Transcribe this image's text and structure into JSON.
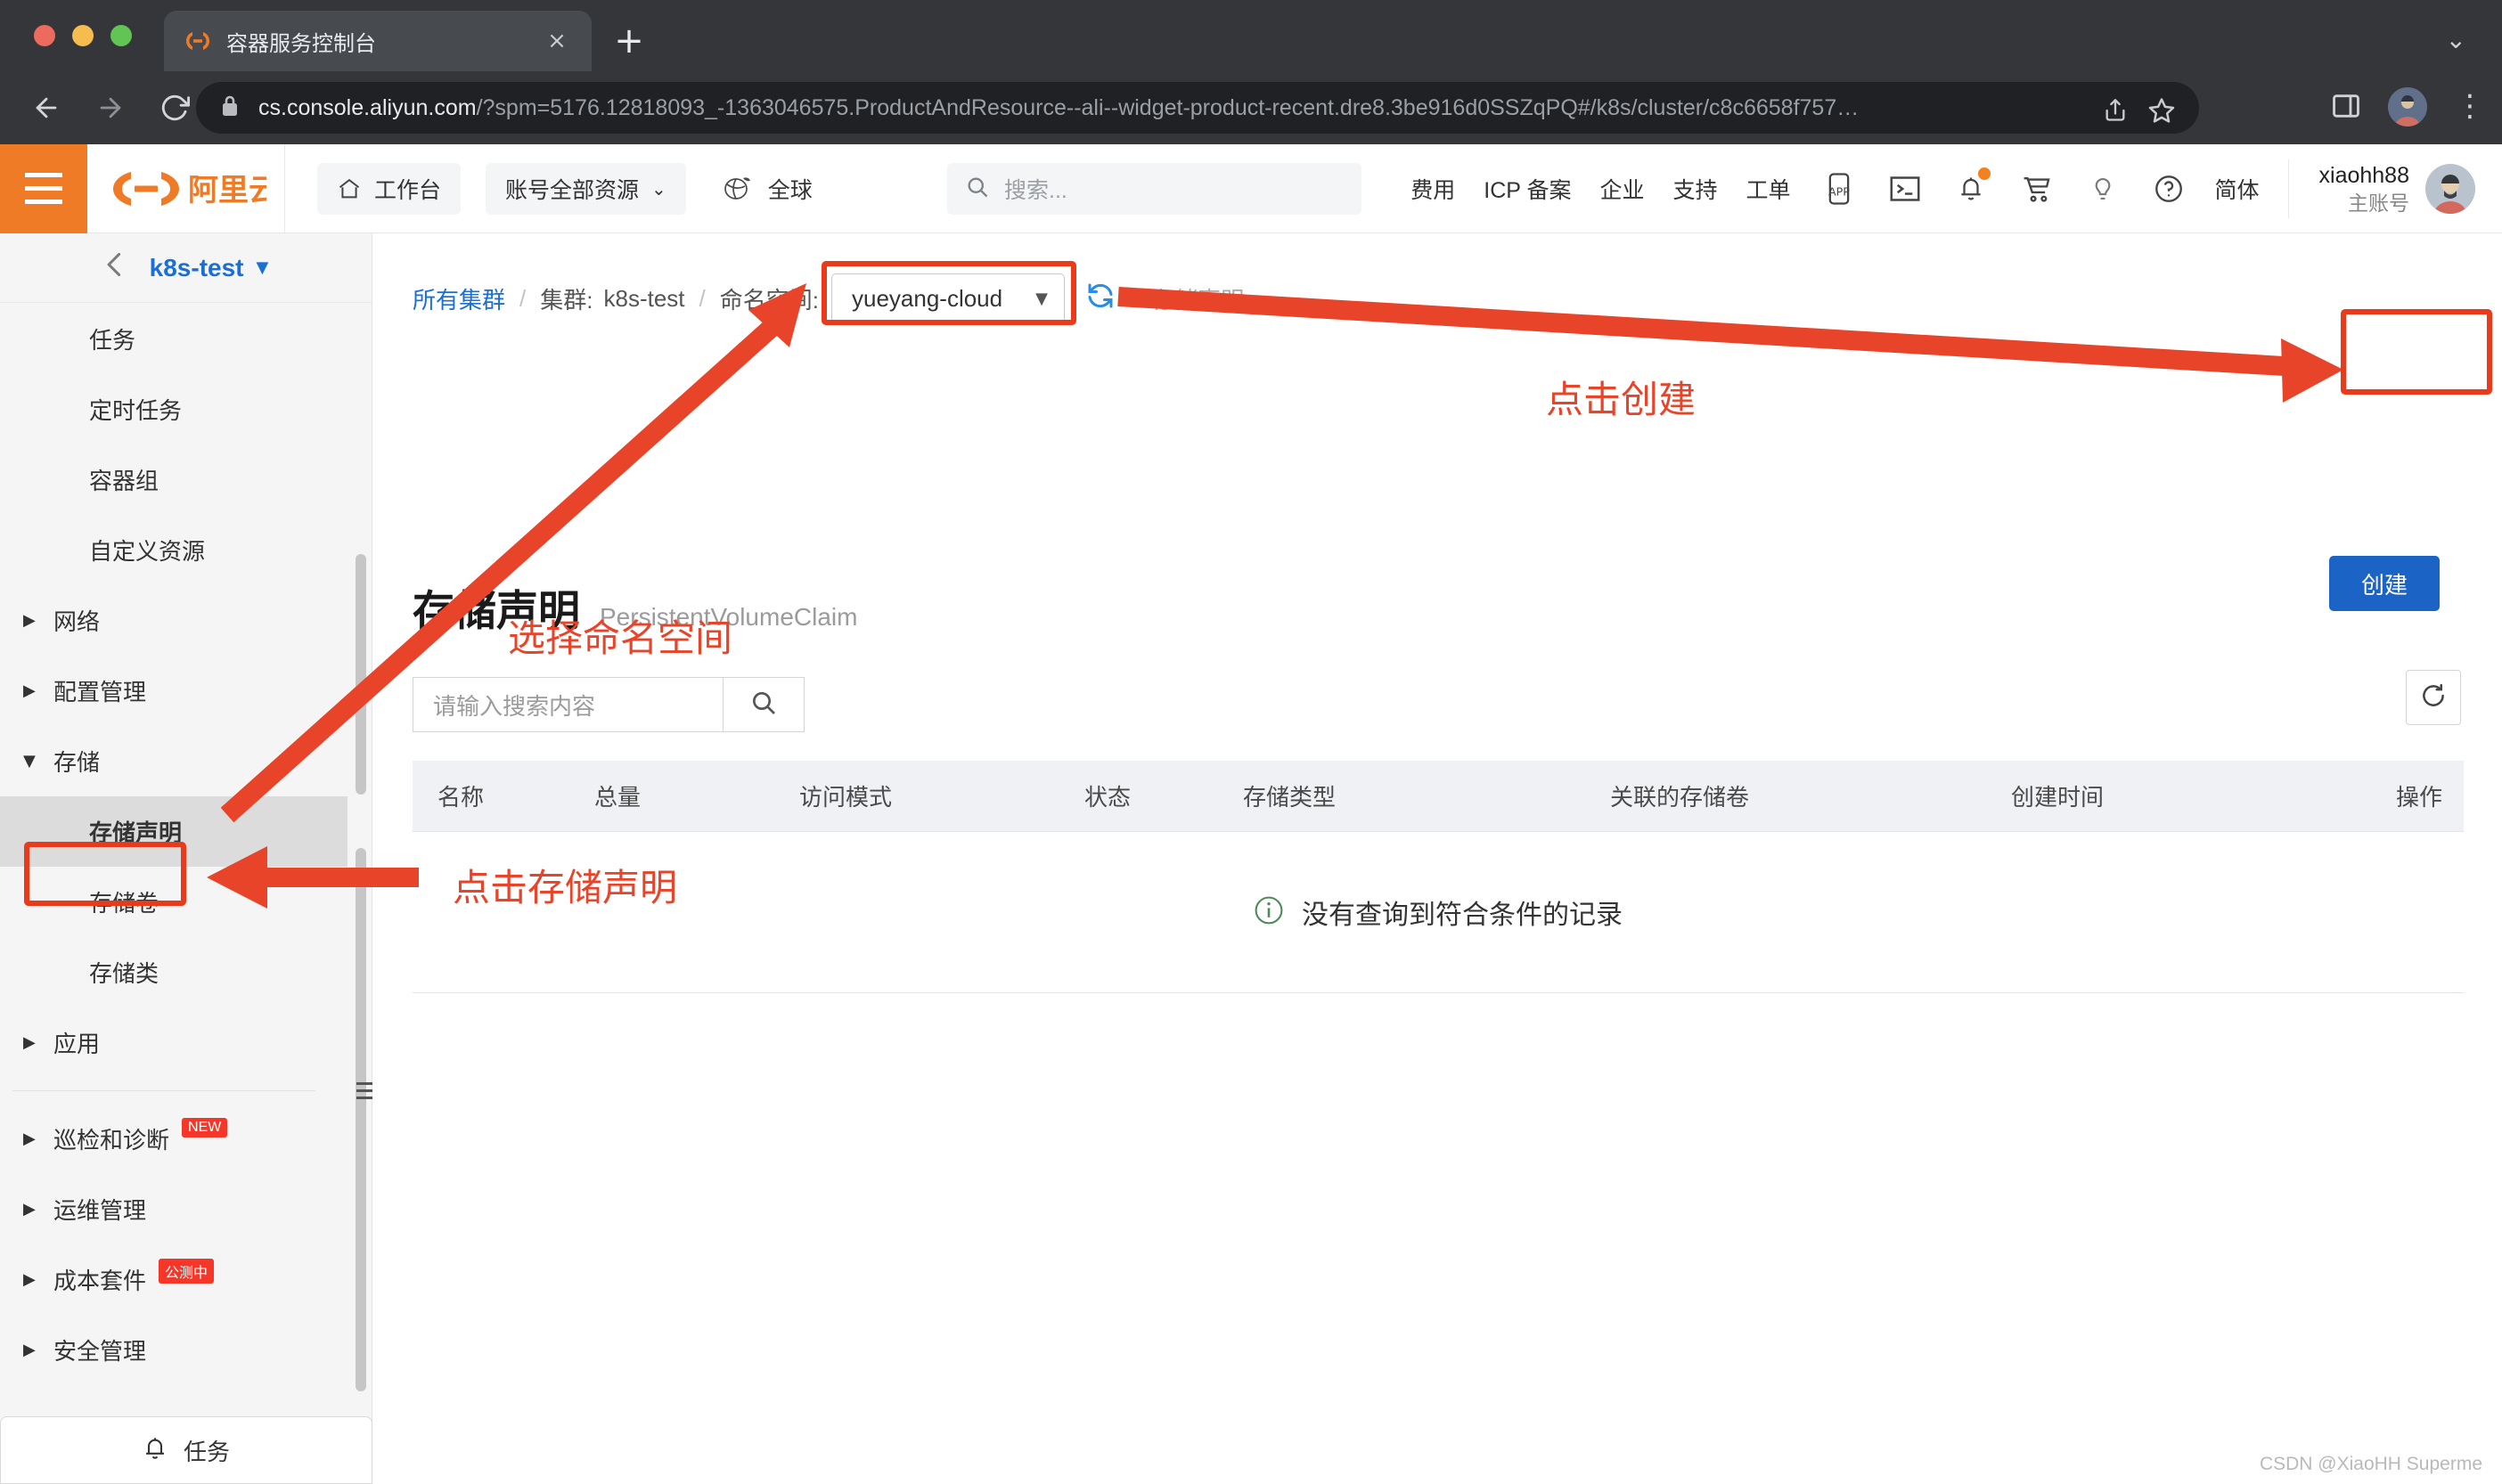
{
  "browser": {
    "tab_title": "容器服务控制台",
    "tab_favicon": "aliyun-logo-icon",
    "tab_close": "×",
    "new_tab": "+",
    "window_menu": "⌄",
    "url_host": "cs.console.aliyun.com",
    "url_rest": "/?spm=5176.12818093_-1363046575.ProductAndResource--ali--widget-product-recent.dre8.3be916d0SSZqPQ#/k8s/cluster/c8c6658f757…",
    "back_icon": "←",
    "forward_icon": "→",
    "reload_icon": "⟳",
    "lock_icon": "lock-icon",
    "share_icon": "share-icon",
    "bookmark_icon": "star-icon",
    "sidepanel_icon": "side-panel-icon",
    "profile_icon": "profile-avatar",
    "menu_icon": "⋮"
  },
  "header": {
    "hamburger": "menu-icon",
    "logo": "阿里云",
    "workbench": "工作台",
    "resources": "账号全部资源",
    "resources_caret": "⌄",
    "region": "全球",
    "globe_icon": "globe-icon",
    "home_icon": "home-icon",
    "search_placeholder": "搜索...",
    "search_icon": "search-icon",
    "links": [
      "费用",
      "ICP 备案",
      "企业",
      "支持",
      "工单"
    ],
    "icons": [
      "app-icon",
      "terminal-icon",
      "bell-icon",
      "cart-icon",
      "bulb-icon",
      "help-icon"
    ],
    "language": "简体",
    "user_name": "xiaohh88",
    "user_sub": "主账号"
  },
  "sidebar": {
    "back_icon": "<",
    "cluster_name": "k8s-test",
    "cluster_caret": "▼",
    "items": [
      {
        "label": "任务",
        "arrow": "",
        "level": "child"
      },
      {
        "label": "定时任务",
        "arrow": "",
        "level": "child"
      },
      {
        "label": "容器组",
        "arrow": "",
        "level": "child"
      },
      {
        "label": "自定义资源",
        "arrow": "",
        "level": "child"
      },
      {
        "label": "网络",
        "arrow": "▶",
        "level": "group"
      },
      {
        "label": "配置管理",
        "arrow": "▶",
        "level": "group"
      },
      {
        "label": "存储",
        "arrow": "▼",
        "level": "group"
      },
      {
        "label": "存储声明",
        "arrow": "",
        "level": "child",
        "active": true
      },
      {
        "label": "存储卷",
        "arrow": "",
        "level": "child"
      },
      {
        "label": "存储类",
        "arrow": "",
        "level": "child"
      },
      {
        "label": "应用",
        "arrow": "▶",
        "level": "group"
      },
      {
        "label": "巡检和诊断",
        "arrow": "▶",
        "level": "group",
        "badge": "NEW"
      },
      {
        "label": "运维管理",
        "arrow": "▶",
        "level": "group"
      },
      {
        "label": "成本套件",
        "arrow": "▶",
        "level": "group",
        "badge": "公测中"
      },
      {
        "label": "安全管理",
        "arrow": "▶",
        "level": "group"
      }
    ],
    "task_button": "任务",
    "task_icon": "bell-icon"
  },
  "main": {
    "breadcrumb": {
      "all_clusters": "所有集群",
      "cluster_label": "集群:",
      "cluster_value": "k8s-test",
      "namespace_label": "命名空间:",
      "namespace_value": "yueyang-cloud",
      "namespace_caret": "▼",
      "refresh_icon": "refresh-icon",
      "current": "存储声明",
      "separator": "/"
    },
    "page_title": "存储声明",
    "page_subtitle": "PersistentVolumeClaim",
    "search_placeholder": "请输入搜索内容",
    "search_icon": "search-icon",
    "refresh_icon": "refresh-icon",
    "create_button": "创建",
    "table": {
      "columns": [
        "名称",
        "总量",
        "访问模式",
        "状态",
        "存储类型",
        "关联的存储卷",
        "创建时间",
        "操作"
      ],
      "rows": [],
      "empty_message": "没有查询到符合条件的记录",
      "empty_icon": "info-icon"
    }
  },
  "annotations": {
    "accent_color": "#e8442a",
    "create_note": "点击创建",
    "namespace_note": "选择命名空间",
    "storage_claim_note": "点击存储声明"
  },
  "watermark": "CSDN @XiaoHH Superme"
}
